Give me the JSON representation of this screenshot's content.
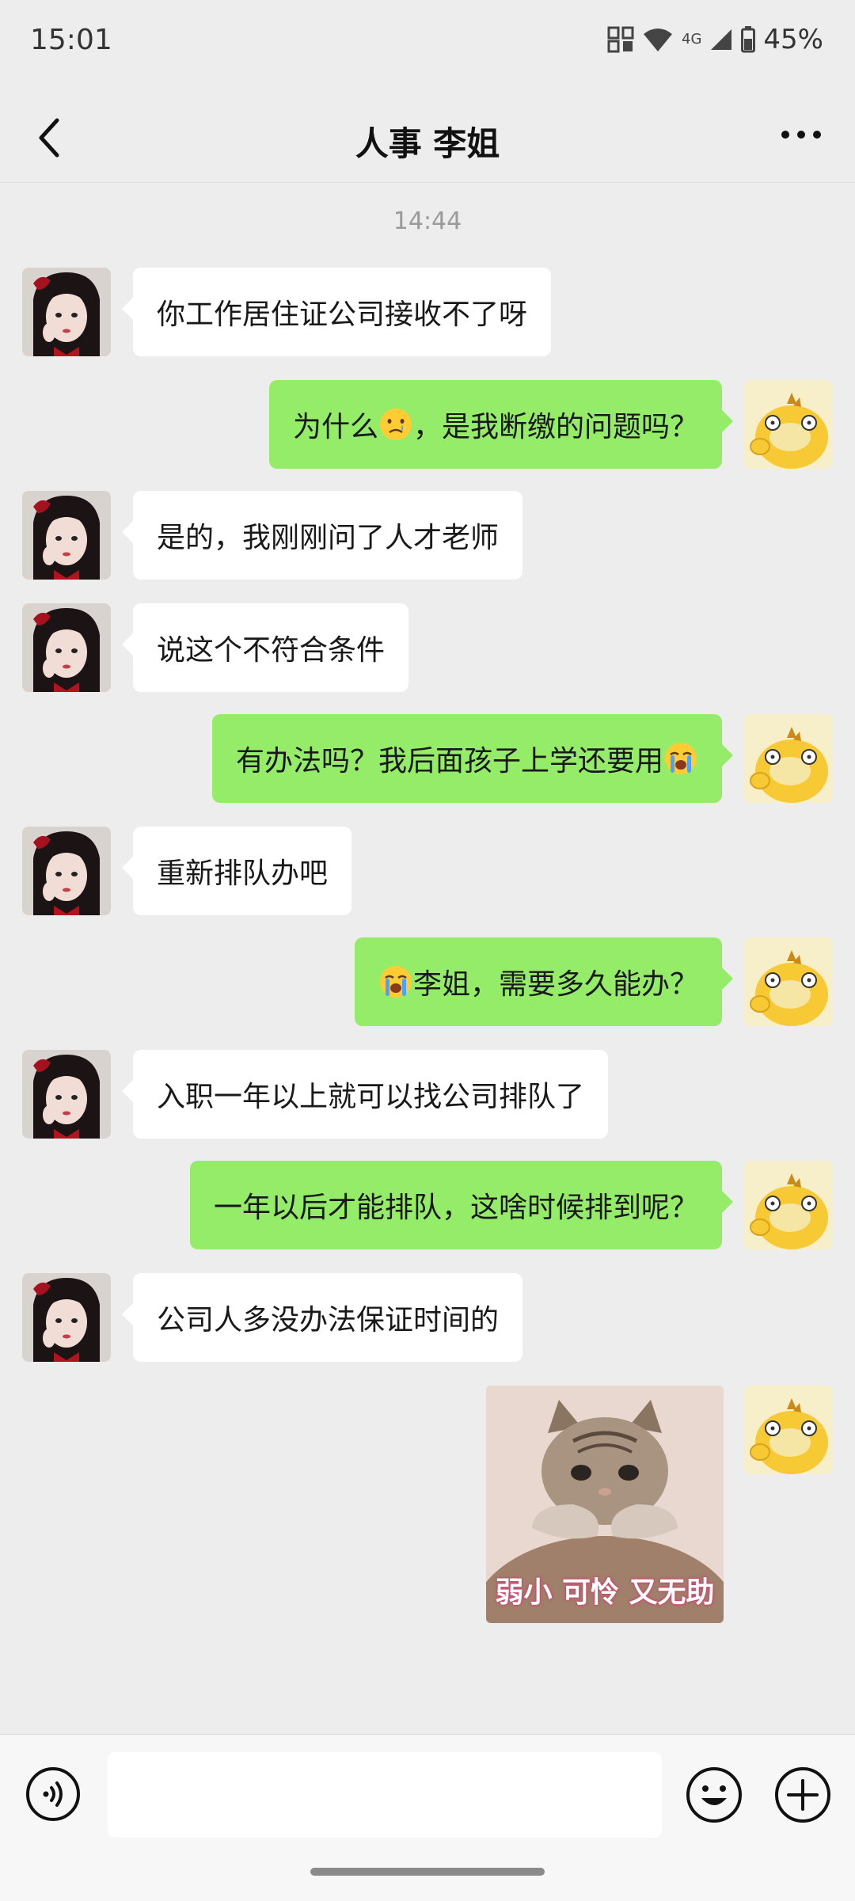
{
  "status_bar": {
    "time": "15:01",
    "network": "4G",
    "battery": "45%"
  },
  "header": {
    "title": "人事 李姐"
  },
  "chat": {
    "timestamp": "14:44",
    "messages": [
      {
        "side": "left",
        "text": "你工作居住证公司接收不了呀"
      },
      {
        "side": "right",
        "text": "为什么",
        "emoji": "crying-face",
        "text_after": "，是我断缴的问题吗？"
      },
      {
        "side": "left",
        "text": "是的，我刚刚问了人才老师"
      },
      {
        "side": "left",
        "text": "说这个不符合条件"
      },
      {
        "side": "right",
        "text": "有办法吗？我后面孩子上学还要用",
        "emoji": "loudly-crying-face"
      },
      {
        "side": "left",
        "text": "重新排队办吧"
      },
      {
        "side": "right",
        "emoji": "loudly-crying-face",
        "text_after": "李姐，需要多久能办？"
      },
      {
        "side": "left",
        "text": "入职一年以上就可以找公司排队了"
      },
      {
        "side": "right",
        "text": "一年以后才能排队，这啥时候排到呢？"
      },
      {
        "side": "left",
        "text": "公司人多没办法保证时间的"
      },
      {
        "side": "right",
        "sticker": "cat-sticker",
        "caption": "弱小 可怜 又无助"
      }
    ]
  },
  "input": {
    "placeholder": ""
  },
  "colors": {
    "self_bubble": "#95ec69",
    "other_bubble": "#ffffff",
    "background": "#ededed"
  }
}
